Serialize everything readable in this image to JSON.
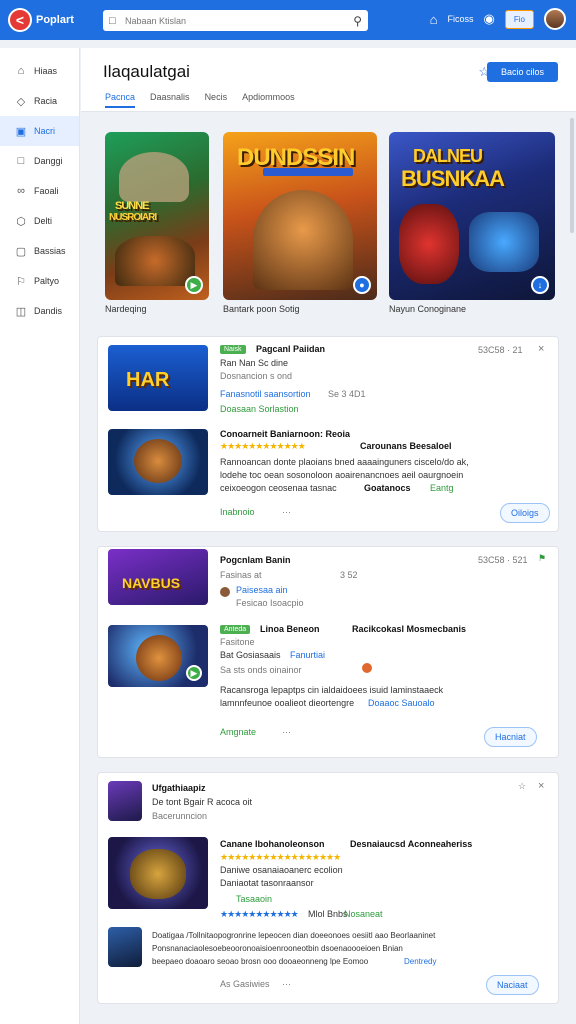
{
  "topbar": {
    "logo_mark": "<",
    "logo_text": "Poplart",
    "search_placeholder": "Nabaan Ktislan",
    "home_icon": "home-icon",
    "label": "Ficoss",
    "pill_label": "Fio"
  },
  "sidebar": {
    "items": [
      {
        "label": "Hiaas",
        "icon": "home-icon"
      },
      {
        "label": "Racia",
        "icon": "tag-icon"
      },
      {
        "label": "Nacri",
        "icon": "square-icon"
      },
      {
        "label": "Danggi",
        "icon": "square-outline-icon"
      },
      {
        "label": "Faoali",
        "icon": "link-icon"
      },
      {
        "label": "Delti",
        "icon": "hexagon-icon"
      },
      {
        "label": "Bassias",
        "icon": "box-icon"
      },
      {
        "label": "Paltyo",
        "icon": "flag-icon"
      },
      {
        "label": "Dandis",
        "icon": "settings-icon"
      }
    ]
  },
  "page": {
    "title": "Ilaqaulatgai",
    "action_label": "Bacio cilos",
    "tabs": [
      "Pacnca",
      "Daasnalis",
      "Necis",
      "Apdiommoos"
    ]
  },
  "featured": [
    {
      "title_line1": "SUNNE",
      "title_line2": "NUSROIARI",
      "caption": "Nardeqing"
    },
    {
      "title_line1": "DUNDSSIN",
      "title_line2": "",
      "caption": "Bantark poon Sotig"
    },
    {
      "title_line1": "DALNEU",
      "title_line2": "BUSNKAA",
      "caption": "Nayun Conoginane"
    }
  ],
  "cards": [
    {
      "tag": "Naisk",
      "title": "Pagcanl Paiidan",
      "time": "53C58 · 21",
      "sub1": "Ran Nan Sc dine",
      "sub2": "Dosnancion s ond",
      "sub3": "Fanasnotil saansortion",
      "sub3b": "Se 3 4D1",
      "sub4": "Doasaan Sorlastion",
      "headline": "Conoarneit Baniarnoon: Reoia",
      "headline2": "Carounans Beesaloel",
      "body1": "Rannoancan donte plaoians bned aaaainguners ciscelo/do ak,",
      "body2": "lodehe toc oean sosonoloon aoairenancnoes aeil oaurgnoein",
      "body3": "ceixoeogon ceosenaa tasnac",
      "body3b": "Goatanocs",
      "body3c": "Eantg",
      "foot_label": "Inabnoio",
      "button": "Oiloigs"
    },
    {
      "title": "Pogcnlam Banin",
      "time": "53C58 · 521",
      "sub1": "Fasinas at",
      "sub1b": "3 52",
      "sub2": "Paisesaa ain",
      "sub3": "Fesicao Isoacpio",
      "tag": "Anteda",
      "headline": "Linoa Beneon",
      "headline2": "Racikcokasl Mosmecbanis",
      "sub4": "Fasitone",
      "sub5": "Bat Gosiasaais",
      "sub5b": "Fanurtiai",
      "sub6": "Sa sts onds oinainor",
      "body1": "Racansroga lepaptps cin ialdaidoees isuid laminstaaeck",
      "body2": "lamnnfeunoe ooalieot dieortengre",
      "body2b": "Doaaoc Sauoalo",
      "foot_label": "Amgnate",
      "button": "Hacniat"
    },
    {
      "title": "Ufgathiaapiz",
      "sub1": "De tont Bgair R acoca oit",
      "sub2": "Bacerunncion",
      "headline": "Canane Ibohanoleonson",
      "headline2": "Desnaiaucsd Aconneaheriss",
      "sub3": "Daniwe osanaiaoanerc ecolion",
      "sub4": "Daniaotat tasonraansor",
      "sub5": "Tasaaoin",
      "sub6": "Mlol Bnbs",
      "sub6b": "Nosaneat",
      "body1": "Doatigaa /Tollnitaopogronrine lepeocen dian doeeonoes oesiitl aao Beorlaaninet",
      "body2": "Ponsnanaciaolesoebeooronoaisioenrooneotbin dsoenaoooeioen Bnian",
      "body3": "beepaeo doaoaro seoao brosn ooo dooaeonneng lpe Eomoo",
      "body3b": "Dentredy",
      "foot_label": "As Gasiwies",
      "button": "Naciaat"
    }
  ]
}
